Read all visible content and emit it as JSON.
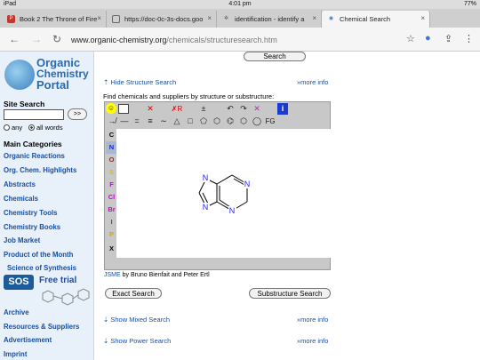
{
  "status_bar": {
    "device": "iPad",
    "time": "4:01 pm",
    "battery": "77%"
  },
  "tabs": [
    {
      "label": "Book 2 The Throne of Fire",
      "icon": "pdf-icon"
    },
    {
      "label": "https://doc-0c-3s-docs.goo",
      "icon": "page-icon"
    },
    {
      "label": "identification - identify a",
      "icon": "gear-icon"
    },
    {
      "label": "Chemical Search",
      "icon": "globe-icon"
    }
  ],
  "address": {
    "domain": "www.organic-chemistry.org",
    "path": "/chemicals/structuresearch.htm"
  },
  "sidebar": {
    "logo": [
      "Organic",
      "Chemistry",
      "Portal"
    ],
    "site_search_label": "Site Search",
    "go_label": ">>",
    "radio_any": "any",
    "radio_all": "all words",
    "categories_heading": "Main Categories",
    "links": [
      "Organic Reactions",
      "Org. Chem. Highlights",
      "Abstracts",
      "Chemicals",
      "Chemistry Tools",
      "Chemistry Books",
      "Job Market",
      "Product of the Month"
    ],
    "sos_heading": "Science of Synthesis",
    "sos_badge": "SOS",
    "free_trial": "Free trial",
    "bottom_links": [
      "Archive",
      "Resources & Suppliers",
      "Advertisement",
      "Imprint"
    ]
  },
  "main": {
    "top_search_button": "Search",
    "hide_structure": "Hide Structure Search",
    "more_info": "»more info",
    "caption": "Find chemicals and suppliers by structure or substructure:",
    "elements": [
      "C",
      "N",
      "O",
      "S",
      "F",
      "Cl",
      "Br",
      "I",
      "P",
      "X"
    ],
    "element_colors": [
      "#000",
      "#1a1aff",
      "#e00",
      "#c8c800",
      "#d000d0",
      "#d000d0",
      "#d000d0",
      "#d000d0",
      "#e0a000",
      "#000"
    ],
    "fg_label": "FG",
    "credit_link": "JSME",
    "credit_text": " by Bruno Bienfait and Peter Ertl",
    "exact_button": "Exact Search",
    "substructure_button": "Substructure Search",
    "show_mixed": "Show Mixed Search",
    "show_power": "Show Power Search",
    "molecule_atoms": {
      "n1": "N",
      "n3": "N",
      "n7": "N",
      "n9": "N"
    }
  }
}
